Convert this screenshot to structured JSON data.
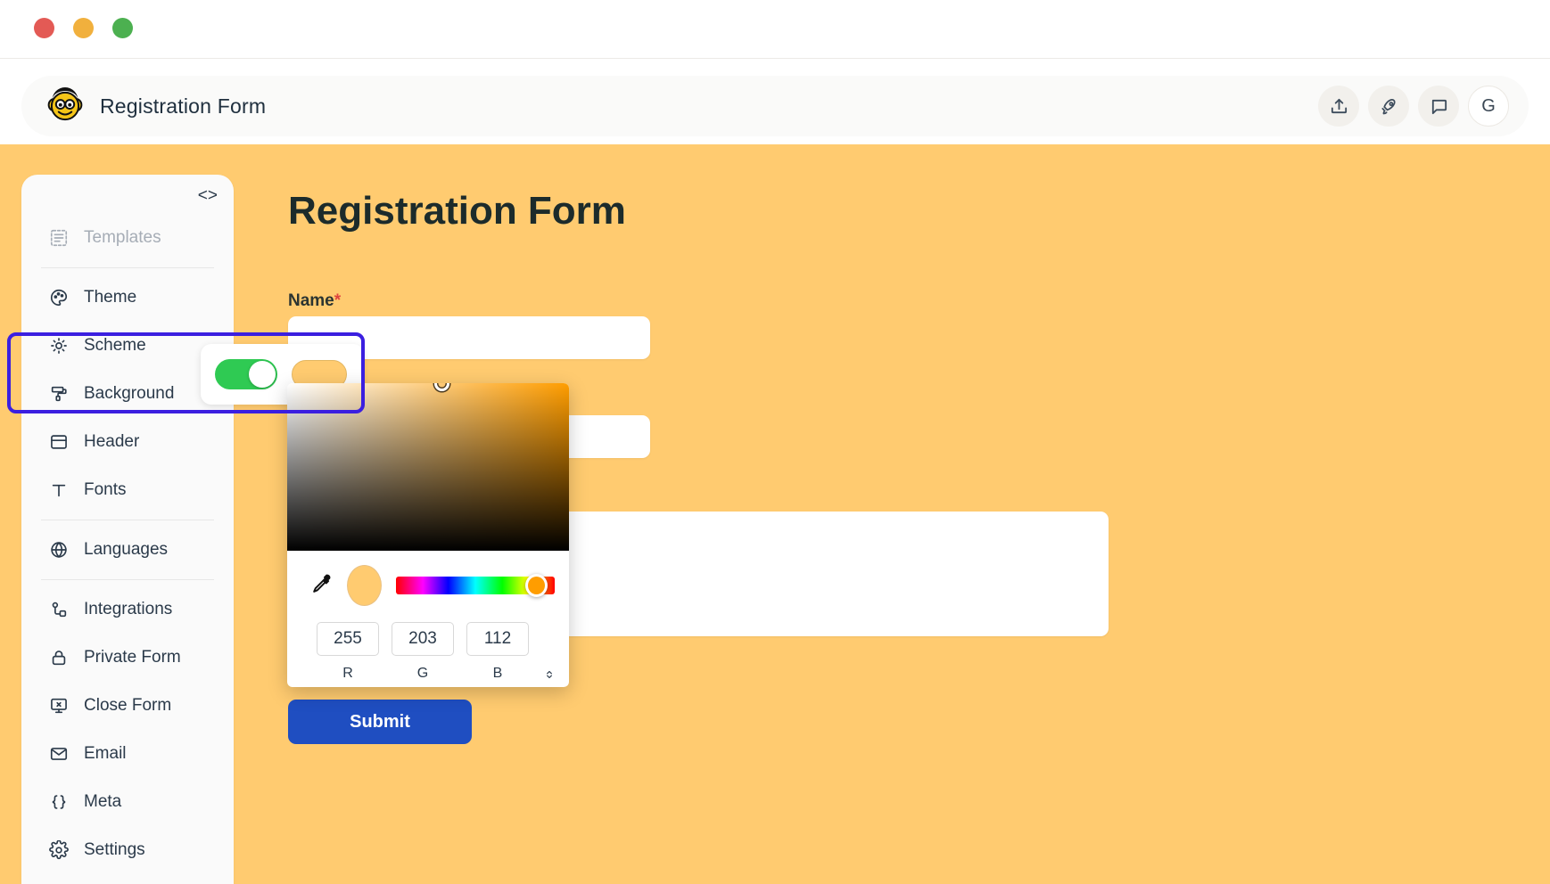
{
  "window": {
    "traffic_lights": [
      "close",
      "minimize",
      "maximize"
    ]
  },
  "appbar": {
    "logo": "monkey-logo",
    "title": "Registration Form",
    "actions": [
      {
        "name": "upload-icon",
        "label": "Upload"
      },
      {
        "name": "rocket-icon",
        "label": "Publish"
      },
      {
        "name": "chat-icon",
        "label": "Comments"
      }
    ],
    "avatar_initial": "G"
  },
  "sidebar": {
    "code_toggle": "<>",
    "items": [
      {
        "label": "Templates",
        "icon": "templates-icon",
        "muted": true,
        "divider_after": true
      },
      {
        "label": "Theme",
        "icon": "palette-icon",
        "muted": false,
        "divider_after": false
      },
      {
        "label": "Scheme",
        "icon": "sun-icon",
        "muted": false,
        "divider_after": false
      },
      {
        "label": "Background",
        "icon": "paint-roller-icon",
        "muted": false,
        "divider_after": false
      },
      {
        "label": "Header",
        "icon": "header-icon",
        "muted": false,
        "divider_after": false
      },
      {
        "label": "Fonts",
        "icon": "text-icon",
        "muted": false,
        "divider_after": true
      },
      {
        "label": "Languages",
        "icon": "globe-icon",
        "muted": false,
        "divider_after": true
      },
      {
        "label": "Integrations",
        "icon": "integrations-icon",
        "muted": false,
        "divider_after": false
      },
      {
        "label": "Private Form",
        "icon": "lock-icon",
        "muted": false,
        "divider_after": false
      },
      {
        "label": "Close Form",
        "icon": "close-form-icon",
        "muted": false,
        "divider_after": false
      },
      {
        "label": "Email",
        "icon": "envelope-icon",
        "muted": false,
        "divider_after": false
      },
      {
        "label": "Meta",
        "icon": "braces-icon",
        "muted": false,
        "divider_after": false
      },
      {
        "label": "Settings",
        "icon": "gear-icon",
        "muted": false,
        "divider_after": false
      }
    ]
  },
  "form": {
    "title": "Registration Form",
    "name_label": "Name",
    "required_marker": "*",
    "submit_label": "Submit",
    "background_color": "#ffcb70",
    "submit_color": "#1f4ec1"
  },
  "background_controls": {
    "toggle_state": "on",
    "toggle_color": "#2fca53",
    "swatch_color": "#ffcb70"
  },
  "color_picker": {
    "eyedropper": "eyedropper-icon",
    "preview_color": "#ffcb70",
    "hue_color": "#ff9d00",
    "channels": [
      {
        "label": "R",
        "value": "255"
      },
      {
        "label": "G",
        "value": "203"
      },
      {
        "label": "B",
        "value": "112"
      }
    ],
    "stepper": "↕"
  },
  "annotation": {
    "target": "Background",
    "color": "#3b1fe0"
  }
}
